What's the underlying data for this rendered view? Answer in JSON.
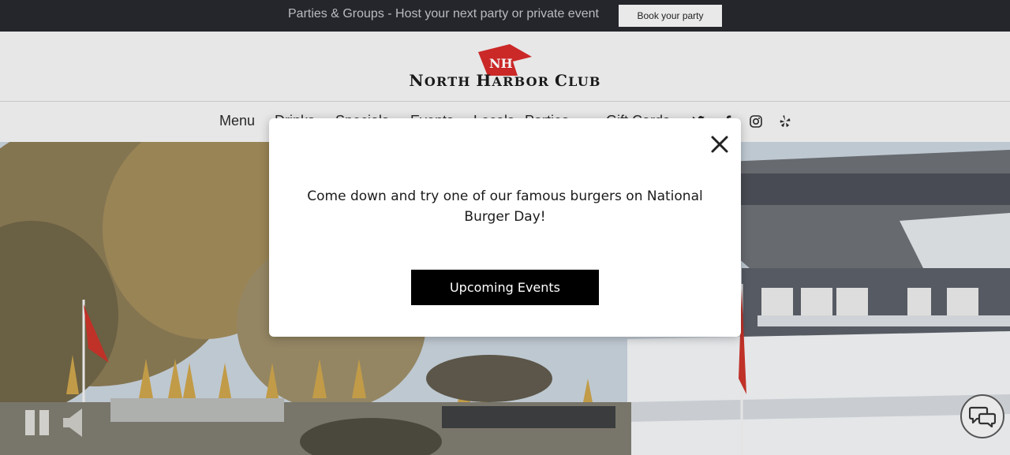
{
  "announcement": {
    "text": "Parties & Groups - Host your next party or private event",
    "button_label": "Book your party"
  },
  "brand": {
    "logo_monogram": "NH",
    "name_parts": [
      "N",
      "ORTH ",
      "H",
      "ARBOR ",
      "C",
      "LUB"
    ],
    "flag_color": "#d42a2a"
  },
  "nav": {
    "items": [
      {
        "label": "Menu"
      },
      {
        "label": "Drinks"
      },
      {
        "label": "Specials"
      },
      {
        "label": "Events"
      },
      {
        "label": "Locals"
      },
      {
        "label": "Parties"
      },
      {
        "label": "Gift Cards"
      }
    ],
    "social": [
      "twitter-icon",
      "facebook-icon",
      "instagram-icon",
      "yelp-icon"
    ]
  },
  "modal": {
    "message": "Come down and try one of our famous burgers on National Burger Day!",
    "button_label": "Upcoming Events"
  },
  "video_controls": [
    "pause-icon",
    "volume-icon"
  ],
  "chat": {
    "icon": "chat-bubbles-icon"
  },
  "colors": {
    "announce_bg": "#24262b",
    "header_bg": "#f1f1f1",
    "modal_button_bg": "#000000",
    "logo_red": "#d42a2a"
  }
}
